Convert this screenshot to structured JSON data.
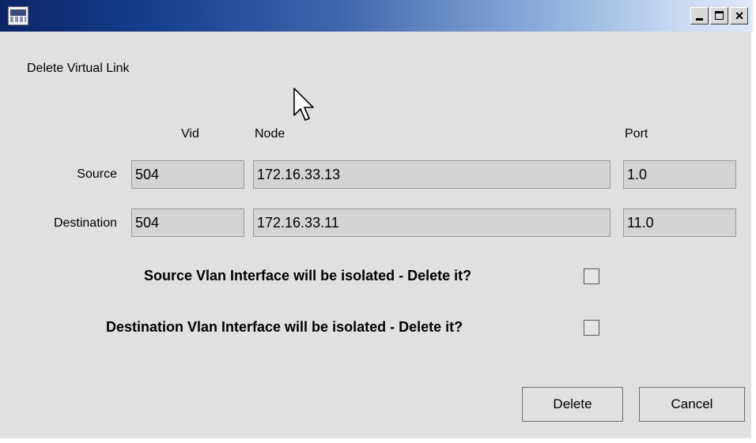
{
  "window": {
    "title": "",
    "controls": [
      "minimize",
      "maximize",
      "close"
    ]
  },
  "heading": "Delete Virtual Link",
  "columns": {
    "vid": "Vid",
    "node": "Node",
    "port": "Port"
  },
  "rows": [
    {
      "label": "Source",
      "vid": "504",
      "node": "172.16.33.13",
      "port": "1.0"
    },
    {
      "label": "Destination",
      "vid": "504",
      "node": "172.16.33.11",
      "port": "11.0"
    }
  ],
  "questions": {
    "source": "Source Vlan Interface will be isolated - Delete it?",
    "destination": "Destination Vlan Interface will be isolated - Delete it?"
  },
  "checkboxes": {
    "source_checked": false,
    "destination_checked": false
  },
  "buttons": {
    "delete": "Delete",
    "cancel": "Cancel"
  },
  "icons": {
    "app": "network-device-icon",
    "cursor": "mouse-pointer-icon"
  }
}
